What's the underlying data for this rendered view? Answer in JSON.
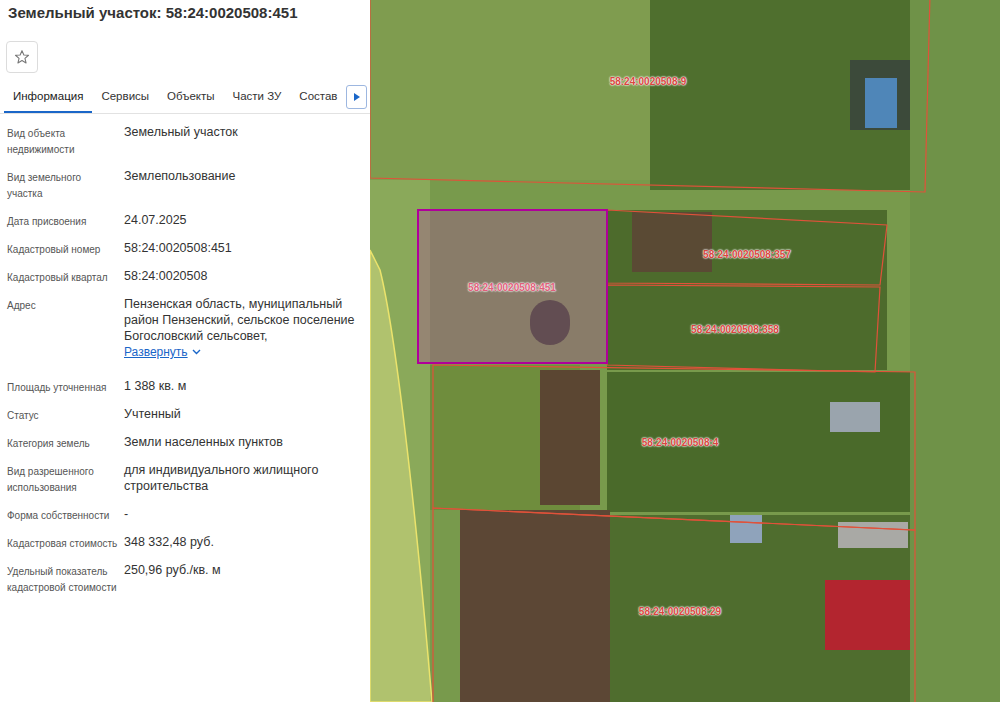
{
  "panel": {
    "title": "Земельный участок: 58:24:0020508:451",
    "tabs": [
      {
        "label": "Информация",
        "selected": true
      },
      {
        "label": "Сервисы",
        "selected": false
      },
      {
        "label": "Объекты",
        "selected": false
      },
      {
        "label": "Части ЗУ",
        "selected": false
      },
      {
        "label": "Состав",
        "selected": false
      }
    ],
    "fields": [
      {
        "label": "Вид объекта недвижимости",
        "value": "Земельный участок"
      },
      {
        "label": "Вид земельного участка",
        "value": "Землепользование"
      },
      {
        "label": "Дата присвоения",
        "value": "24.07.2025"
      },
      {
        "label": "Кадастровый номер",
        "value": "58:24:0020508:451"
      },
      {
        "label": "Кадастровый квартал",
        "value": "58:24:0020508"
      },
      {
        "label": "Адрес",
        "value": "Пензенская область, муниципальный район Пензенский, сельское поселение Богословский сельсовет,",
        "link": "Развернуть"
      },
      {
        "label": "Площадь уточненная",
        "value": "1 388 кв. м"
      },
      {
        "label": "Статус",
        "value": "Учтенный"
      },
      {
        "label": "Категория земель",
        "value": "Земли населенных пунктов"
      },
      {
        "label": "Вид разрешенного использования",
        "value": "для индивидуального жилищного строительства"
      },
      {
        "label": "Форма собственности",
        "value": "-"
      },
      {
        "label": "Кадастровая стоимость",
        "value": "348 332,48 руб."
      },
      {
        "label": "Удельный показатель кадастровой стоимости",
        "value": "250,96 руб./кв. м"
      }
    ]
  },
  "map": {
    "parcels": [
      {
        "label": "58:24:0020508:9",
        "selected": false
      },
      {
        "label": "58:24:0020508:357",
        "selected": false
      },
      {
        "label": "58:24:0020508:451",
        "selected": true
      },
      {
        "label": "58:24:0020508:358",
        "selected": false
      },
      {
        "label": "58:24:0020508:4",
        "selected": false
      },
      {
        "label": "58:24:0020508:29",
        "selected": false
      }
    ]
  }
}
